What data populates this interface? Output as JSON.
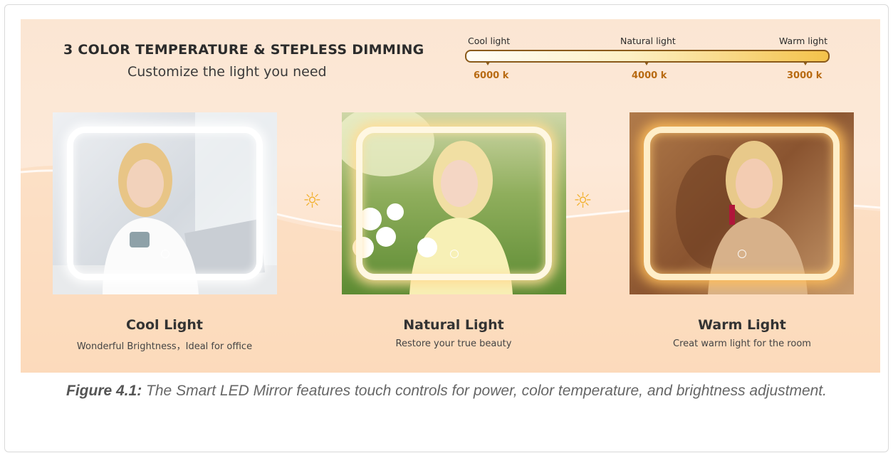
{
  "banner": {
    "headline": "3 COLOR TEMPERATURE & STEPLESS DIMMING",
    "subline": "Customize the light you need"
  },
  "scale": {
    "labels": [
      "Cool light",
      "Natural light",
      "Warm light"
    ],
    "values": [
      "6000 k",
      "4000 k",
      "3000 k"
    ]
  },
  "panels": [
    {
      "title": "Cool Light",
      "subtitle": "Wonderful Brightness，Ideal for office"
    },
    {
      "title": "Natural Light",
      "subtitle": "Restore your true beauty"
    },
    {
      "title": "Warm Light",
      "subtitle": "Creat warm light for the room"
    }
  ],
  "figure": {
    "label": "Figure 4.1:",
    "caption": "The Smart LED Mirror features touch controls for power, color temperature, and brightness adjustment."
  }
}
